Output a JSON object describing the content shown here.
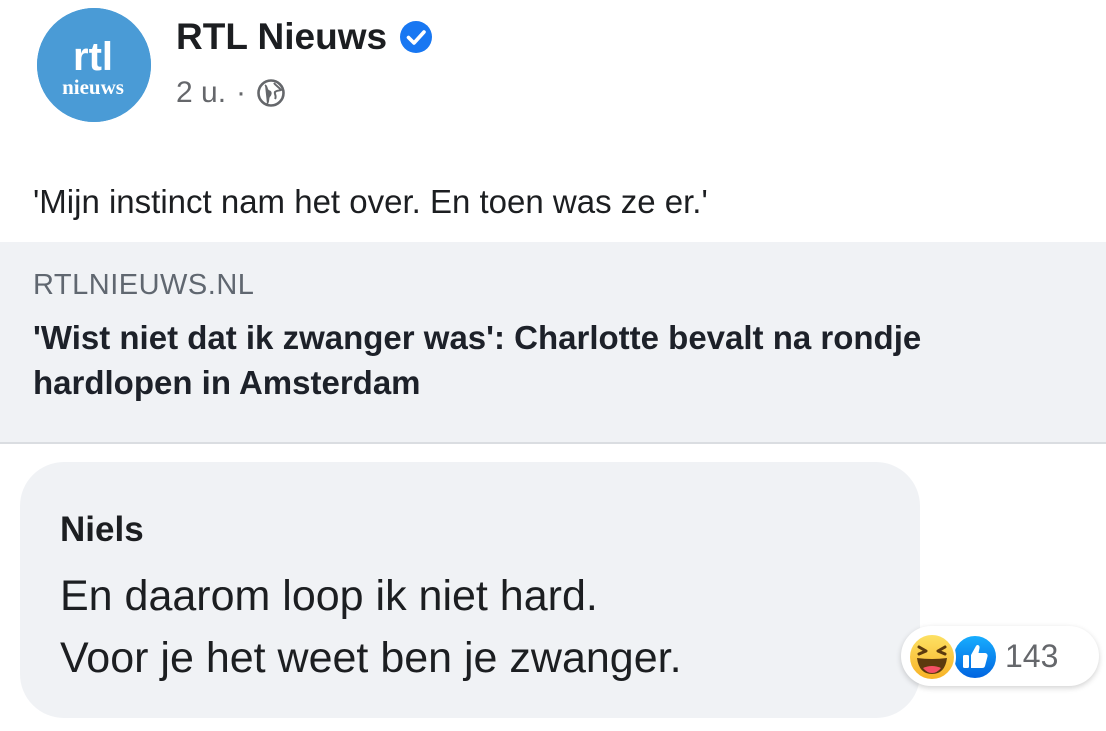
{
  "post": {
    "page_name": "RTL Nieuws",
    "avatar_logo_top": "rtl",
    "avatar_logo_bottom": "nieuws",
    "time": "2 u.",
    "separator": "·",
    "audience_icon": "globe-icon",
    "verified_icon": "verified-badge-icon",
    "caption": "'Mijn instinct nam het over. En toen was ze er.'"
  },
  "link_preview": {
    "domain": "RTLNIEUWS.NL",
    "title": "'Wist niet dat ik zwanger was': Charlotte bevalt na rondje hardlopen in Amsterdam"
  },
  "comment": {
    "author": "Niels",
    "text": "En daarom loop ik niet hard.\nVoor je het weet ben je zwanger.",
    "reactions": {
      "icons": [
        "haha-icon",
        "like-icon"
      ],
      "count": "143"
    }
  },
  "colors": {
    "accent_blue": "#1877f2",
    "avatar_blue": "#4a9bd6",
    "card_bg": "#f0f2f5",
    "secondary_text": "#65676b"
  }
}
